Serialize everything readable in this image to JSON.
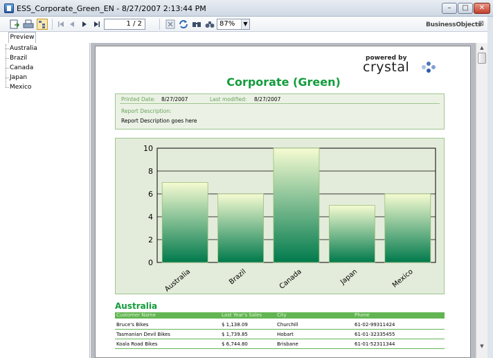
{
  "window": {
    "title": "ESS_Corporate_Green_EN - 8/27/2007 2:13:44 PM",
    "minimize": "–",
    "maximize": "□",
    "close": "✕"
  },
  "toolbar": {
    "page_value": "1 / 2",
    "zoom_value": "87%",
    "zoom_arrow": "▼",
    "brand": "BusinessObjects",
    "close_glyph": "⊠"
  },
  "tabs": {
    "preview": "Preview"
  },
  "tree": {
    "items": [
      "Australia",
      "Brazil",
      "Canada",
      "Japan",
      "Mexico"
    ]
  },
  "report": {
    "powered_by": "powered by",
    "crystal": "crystal",
    "title": "Corporate (Green)",
    "printed_label": "Printed Date:",
    "printed_value": "8/27/2007",
    "modified_label": "Last modified:",
    "modified_value": "8/27/2007",
    "desc_label": "Report Description:",
    "desc_value": "Report Description goes here",
    "section": "Australia",
    "columns": [
      "Customer Name",
      "Last Year's Sales",
      "City",
      "Phone"
    ],
    "rows": [
      [
        "Bruce's Bikes",
        "$ 1,138.09",
        "Churchill",
        "61-02-99311424"
      ],
      [
        "Tasmanian Devil Bikes",
        "$ 1,739.85",
        "Hobart",
        "61-01-32335455"
      ],
      [
        "Koala Road Bikes",
        "$ 6,744.80",
        "Brisbane",
        "61-01-52311344"
      ]
    ]
  },
  "chart_data": {
    "type": "bar",
    "categories": [
      "Australia",
      "Brazil",
      "Canada",
      "Japan",
      "Mexico"
    ],
    "values": [
      7,
      6,
      10,
      5,
      6
    ],
    "ylim": [
      0,
      10
    ],
    "yticks": [
      0,
      2,
      4,
      6,
      8,
      10
    ],
    "grid": true,
    "colors": {
      "bar_top": "#f6fbd2",
      "bar_bottom": "#007a4c",
      "plot_bg": "#e3ecda"
    }
  }
}
